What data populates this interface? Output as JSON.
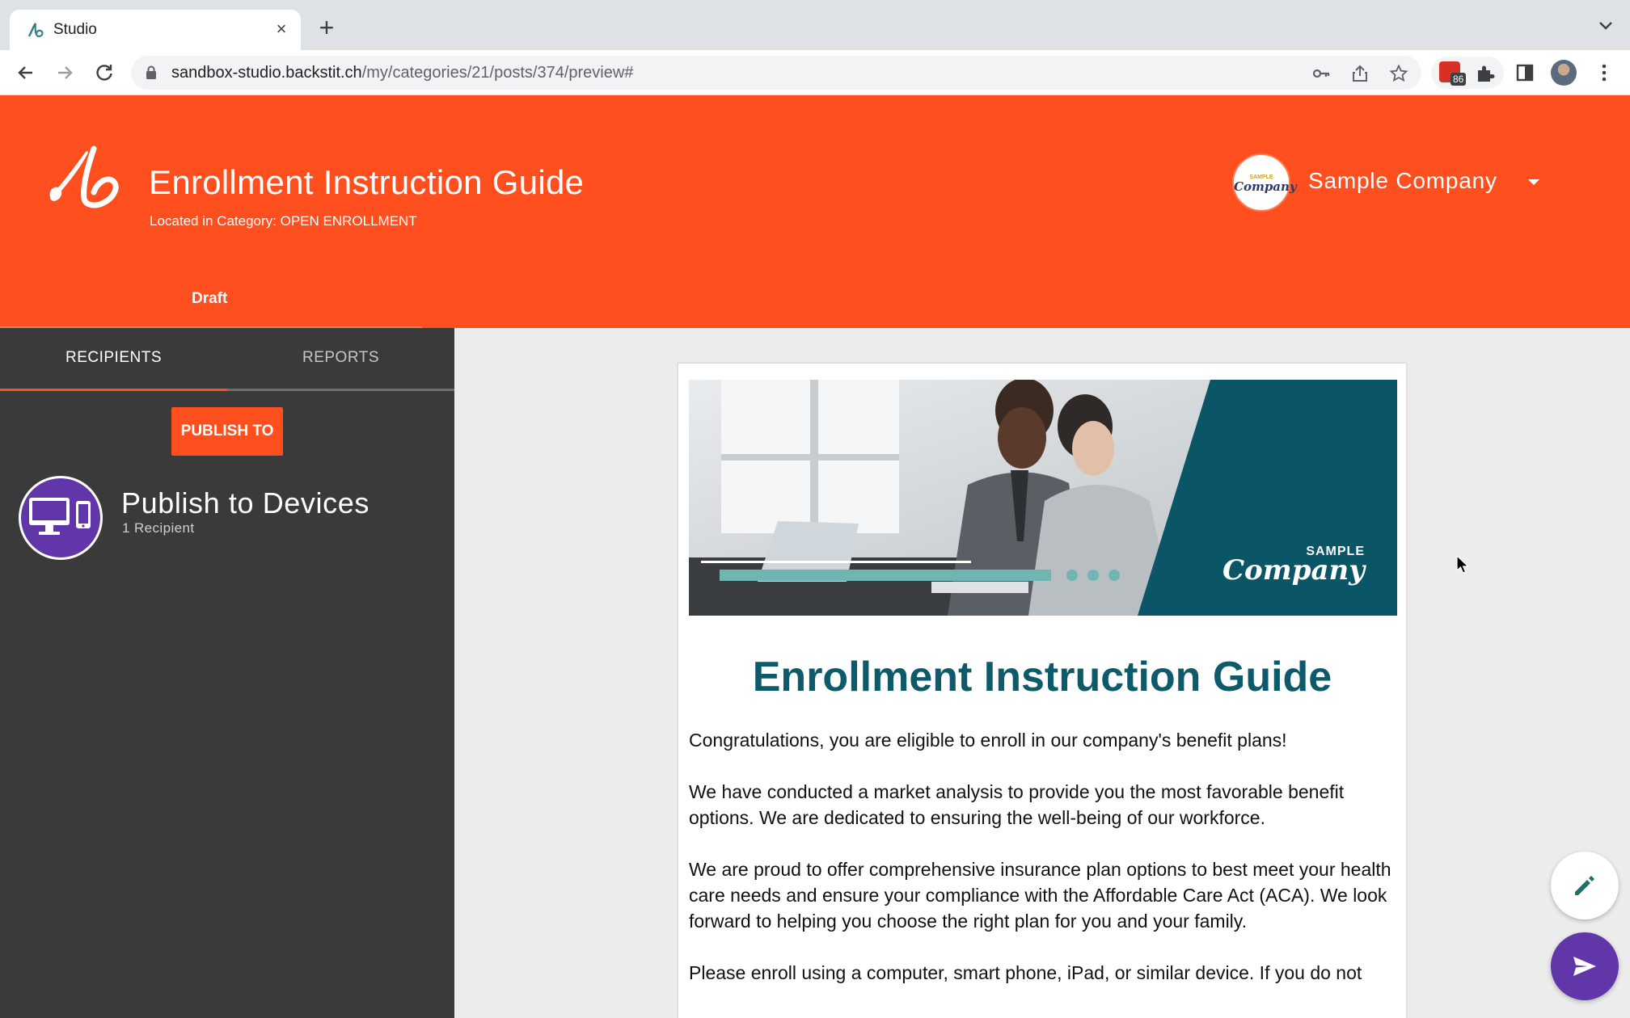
{
  "browser": {
    "tab_title": "Studio",
    "url_host": "sandbox-studio.backstit.ch",
    "url_path": "/my/categories/21/posts/374/preview#",
    "extension_badge": "86"
  },
  "header": {
    "post_title": "Enrollment Instruction Guide",
    "category_line": "Located in Category: OPEN ENROLLMENT",
    "company_name": "Sample Company",
    "company_logo_small": "SAMPLE",
    "company_logo_main": "Company",
    "status_tab": "Draft",
    "brand_color": "#ff4f1f"
  },
  "left_panel": {
    "tabs": [
      {
        "label": "RECIPIENTS",
        "active": true
      },
      {
        "label": "REPORTS",
        "active": false
      }
    ],
    "publish_button": "PUBLISH TO",
    "channel": {
      "title": "Publish to Devices",
      "subtitle": "1 Recipient",
      "icon": "devices-icon"
    }
  },
  "document": {
    "hero_brand_small": "SAMPLE",
    "hero_brand_main": "Company",
    "title": "Enrollment Instruction Guide",
    "paragraphs": [
      "Congratulations, you are eligible to enroll in our company's benefit plans!",
      "We have conducted a market analysis to provide you the most favorable benefit options. We are dedicated to ensuring the well-being of our workforce.",
      "We are proud to offer comprehensive insurance plan options to best meet your health care needs and ensure your compliance with the Affordable Care Act (ACA). We look forward to helping you choose the right plan for you and your family.",
      "Please enroll using a computer, smart phone, iPad, or similar device. If you do not"
    ],
    "title_color": "#0d5a6a"
  },
  "fabs": {
    "edit_icon": "pencil-icon",
    "send_icon": "send-icon"
  }
}
